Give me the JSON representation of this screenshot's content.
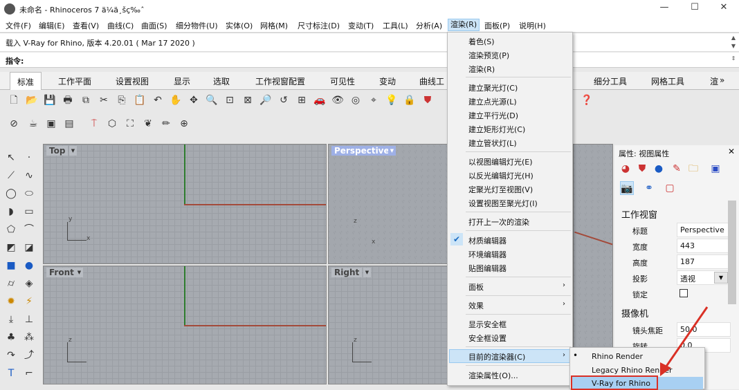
{
  "window": {
    "title": "未命名 - Rhinoceros 7 ä¼ä¸šç‰ˆ",
    "minimize": "—",
    "maximize": "☐",
    "close": "✕"
  },
  "menubar": [
    "文件(F)",
    "编辑(E)",
    "查看(V)",
    "曲线(C)",
    "曲面(S)",
    "细分物件(U)",
    "实体(O)",
    "网格(M)",
    "尺寸标注(D)",
    "变动(T)",
    "工具(L)",
    "分析(A)",
    "渲染(R)",
    "面板(P)",
    "说明(H)"
  ],
  "command": {
    "history": "载入 V-Ray for Rhino, 版本 4.20.01 ( Mar 17 2020 )",
    "prompt": "指令:"
  },
  "tabs": [
    "标准",
    "工作平面",
    "设置视图",
    "显示",
    "选取",
    "工作视窗配置",
    "可见性",
    "变动",
    "曲线工",
    "细分工具",
    "网格工具",
    "渲"
  ],
  "tabs_more": "»",
  "viewports": {
    "top": "Top",
    "perspective": "Perspective",
    "front": "Front",
    "right": "Right"
  },
  "render_menu": {
    "items": [
      "着色(S)",
      "渲染预览(P)",
      "渲染(R)",
      "建立聚光灯(C)",
      "建立点光源(L)",
      "建立平行光(D)",
      "建立矩形灯光(C)",
      "建立管状灯(L)",
      "以视图编辑灯光(E)",
      "以反光编辑灯光(H)",
      "定聚光灯至视图(V)",
      "设置视图至聚光灯(I)",
      "打开上一次的渲染",
      "材质编辑器",
      "环境编辑器",
      "贴图编辑器",
      "面板",
      "效果",
      "显示安全框",
      "安全框设置",
      "目前的渲染器(C)",
      "渲染属性(O)..."
    ],
    "checked": "✔",
    "submenu_arrow": "›"
  },
  "renderer_submenu": {
    "items": [
      "Rhino Render",
      "Legacy Rhino Render",
      "V-Ray for Rhino"
    ],
    "current_mark": "•"
  },
  "properties": {
    "title": "属性: 视图属性",
    "section_viewport": "工作视窗",
    "rows": [
      {
        "label": "标题",
        "value": "Perspective"
      },
      {
        "label": "宽度",
        "value": "443"
      },
      {
        "label": "高度",
        "value": "187"
      },
      {
        "label": "投影",
        "value": "透视"
      },
      {
        "label": "锁定",
        "value": ""
      }
    ],
    "section_camera": "摄像机",
    "camera_rows": [
      {
        "label": "镜头焦距",
        "value": "50.0"
      },
      {
        "label": "旋转",
        "value": "0.0"
      }
    ]
  },
  "colors": {
    "highlight": "#cce4f7",
    "annotation": "#d93025",
    "axis_x": "#a34a3a",
    "axis_y": "#2e7d2e"
  }
}
